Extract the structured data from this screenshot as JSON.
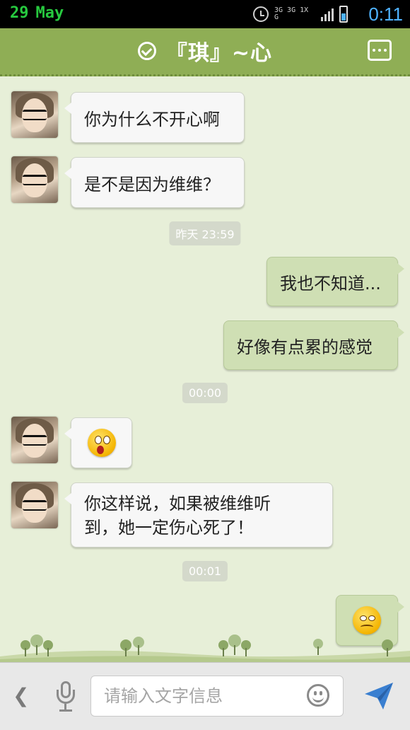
{
  "status_bar": {
    "day": "29",
    "month": "May",
    "network_label": "3G 3G 1X G",
    "time": "0:11"
  },
  "header": {
    "title": "『琪』~心"
  },
  "messages": [
    {
      "side": "left",
      "type": "text",
      "text": "你为什么不开心啊"
    },
    {
      "side": "left",
      "type": "text",
      "text": "是不是因为维维？"
    },
    {
      "type": "timestamp",
      "text": "昨天 23:59"
    },
    {
      "side": "right",
      "type": "text",
      "text": "我也不知道..."
    },
    {
      "side": "right",
      "type": "text",
      "text": "好像有点累的感觉"
    },
    {
      "type": "timestamp",
      "text": "00:00"
    },
    {
      "side": "left",
      "type": "emoji",
      "emoji": "surprised-face"
    },
    {
      "side": "left",
      "type": "text",
      "text": "你这样说，如果被维维听到，她一定伤心死了！"
    },
    {
      "type": "timestamp",
      "text": "00:01"
    },
    {
      "side": "right",
      "type": "emoji",
      "emoji": "worried-face"
    }
  ],
  "input_bar": {
    "placeholder": "请输入文字信息"
  },
  "colors": {
    "header_bg": "#8fae55",
    "chat_bg": "#e7efd8",
    "my_bubble": "#cfdfb4",
    "their_bubble": "#f7f7f7",
    "send_icon": "#3a7fd0"
  }
}
